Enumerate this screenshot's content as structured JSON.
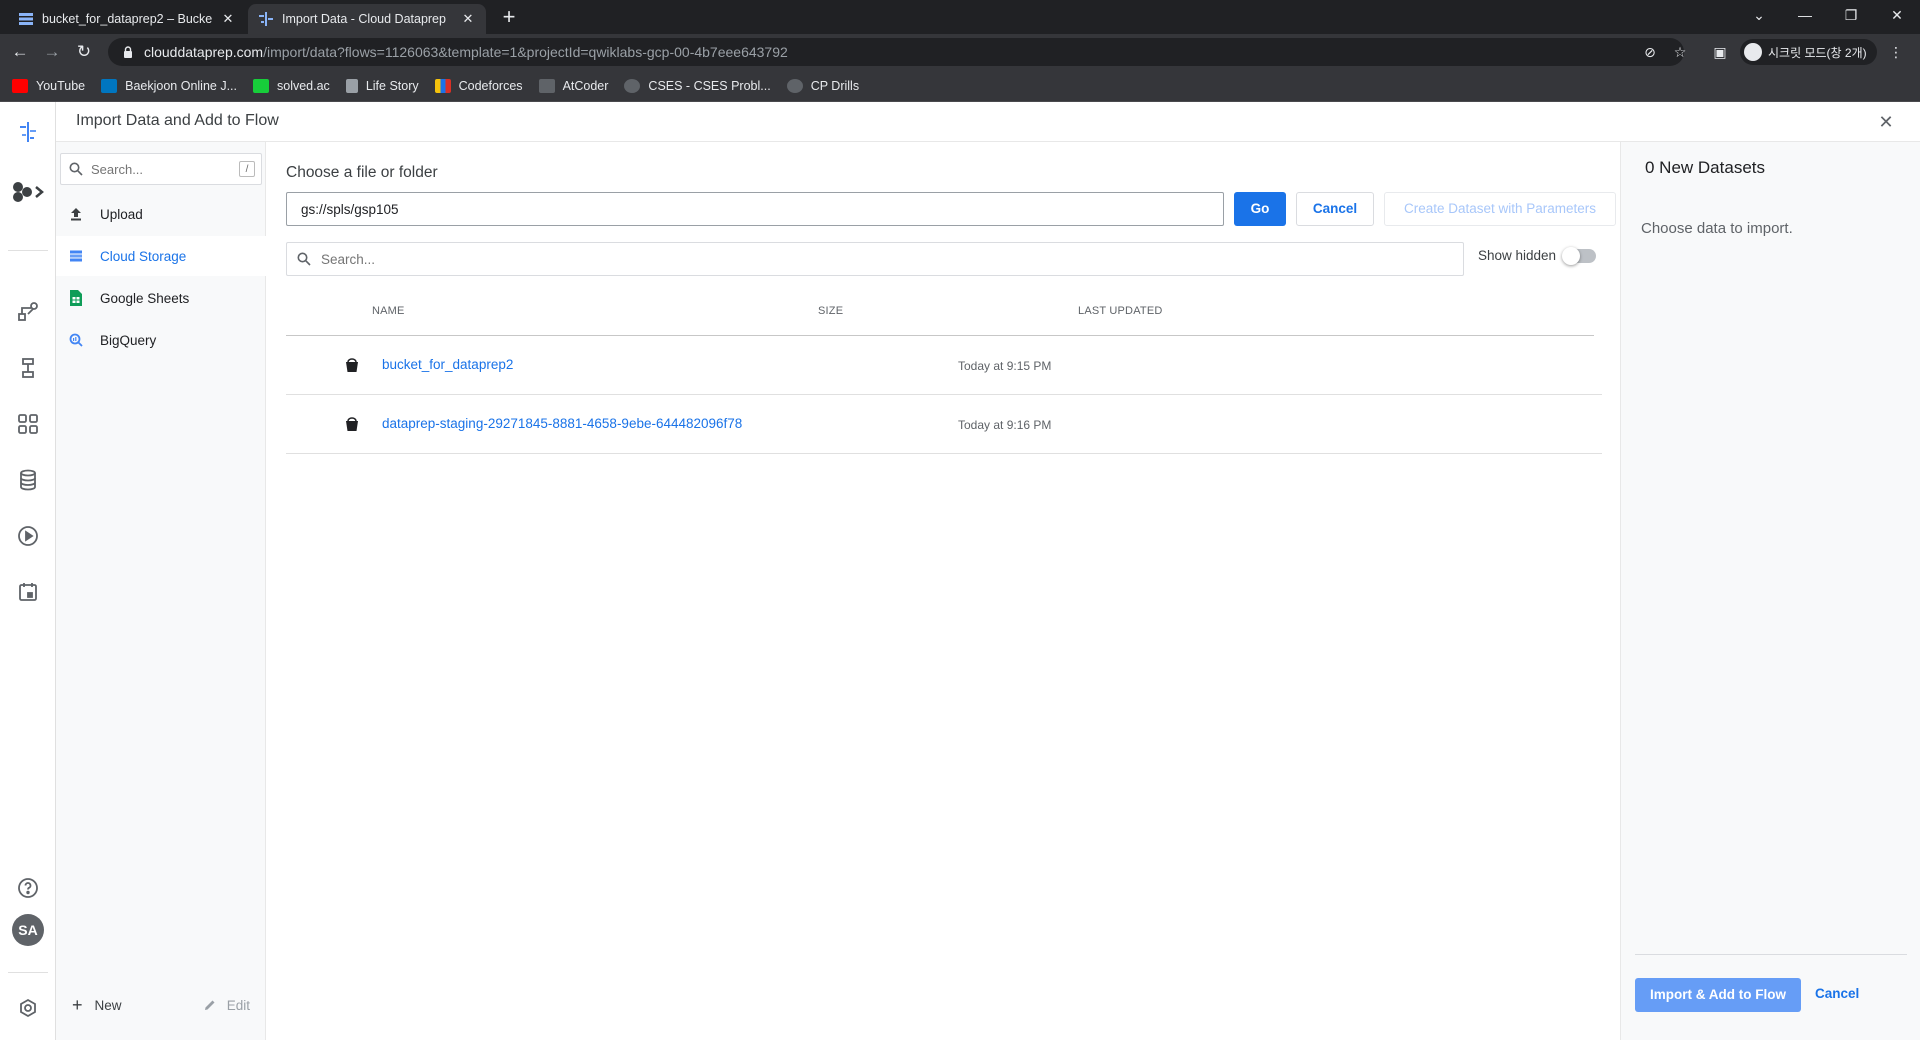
{
  "browser": {
    "tabs": [
      {
        "title": "bucket_for_dataprep2 – Bucket details – Cloud Storage",
        "active": false
      },
      {
        "title": "Import Data - Cloud Dataprep",
        "active": true
      }
    ],
    "url_host": "clouddataprep.com",
    "url_rest": "/import/data?flows=1126063&template=1&projectId=qwiklabs-gcp-00-4b7eee643792",
    "profile_label": "시크릿 모드(창 2개)",
    "bookmarks": [
      {
        "label": "YouTube",
        "color": "#ff0000"
      },
      {
        "label": "Baekjoon Online J...",
        "color": "#0076c0"
      },
      {
        "label": "solved.ac",
        "color": "#17ce3a"
      },
      {
        "label": "Life Story",
        "color": "#9aa0a6"
      },
      {
        "label": "Codeforces",
        "color": "#f4c20d"
      },
      {
        "label": "AtCoder",
        "color": "#9aa0a6"
      },
      {
        "label": "CSES - CSES Probl...",
        "color": "#9aa0a6"
      },
      {
        "label": "CP Drills",
        "color": "#9aa0a6"
      }
    ]
  },
  "header": {
    "title": "Import Data and Add to Flow"
  },
  "sources": {
    "search_placeholder": "Search...",
    "shortcut": "/",
    "items": [
      {
        "label": "Upload",
        "icon": "upload-icon",
        "active": false
      },
      {
        "label": "Cloud Storage",
        "icon": "cloud-storage-icon",
        "active": true
      },
      {
        "label": "Google Sheets",
        "icon": "google-sheets-icon",
        "active": false
      },
      {
        "label": "BigQuery",
        "icon": "bigquery-icon",
        "active": false
      }
    ],
    "new_label": "New",
    "edit_label": "Edit"
  },
  "main": {
    "choose_label": "Choose a file or folder",
    "path_value": "gs://spls/gsp105",
    "go_label": "Go",
    "cancel_label": "Cancel",
    "params_label": "Create Dataset with Parameters",
    "search_placeholder": "Search...",
    "show_hidden_label": "Show hidden",
    "show_hidden_on": false,
    "columns": [
      "NAME",
      "SIZE",
      "LAST UPDATED"
    ],
    "rows": [
      {
        "name": "bucket_for_dataprep2",
        "size": "",
        "updated": "Today at 9:15 PM"
      },
      {
        "name": "dataprep-staging-29271845-8881-4658-9ebe-644482096f78",
        "size": "",
        "updated": "Today at 9:16 PM"
      }
    ]
  },
  "datasets": {
    "count_label": "0 New Datasets",
    "hint": "Choose data to import.",
    "import_label": "Import & Add to Flow",
    "cancel_label": "Cancel"
  },
  "rail": {
    "avatar_initials": "SA"
  },
  "colors": {
    "accent": "#1a73e8",
    "accent_disabled": "#669df6"
  }
}
